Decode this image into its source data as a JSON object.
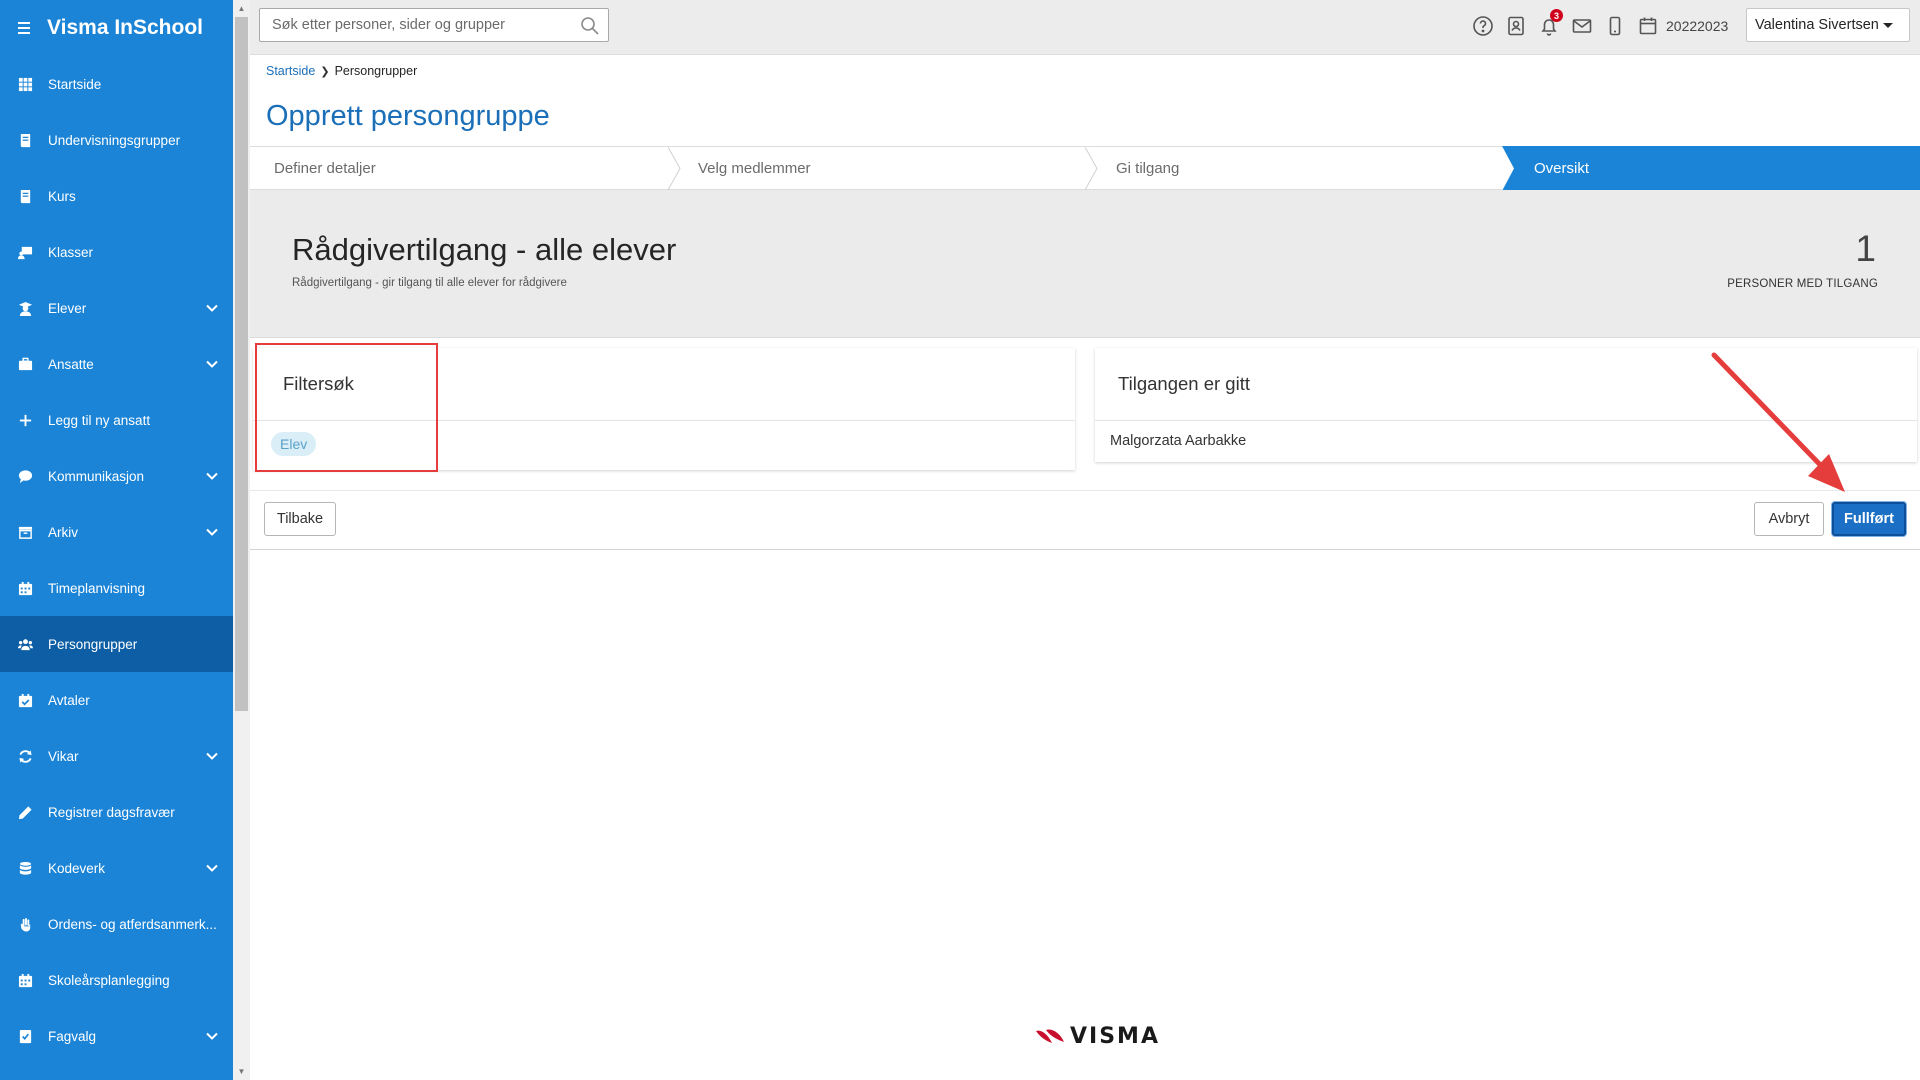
{
  "app": {
    "title": "Visma InSchool"
  },
  "sidebar": {
    "items": [
      {
        "label": "Startside",
        "icon": "grid-icon",
        "expandable": false
      },
      {
        "label": "Undervisningsgrupper",
        "icon": "book-icon",
        "expandable": false
      },
      {
        "label": "Kurs",
        "icon": "book-icon",
        "expandable": false
      },
      {
        "label": "Klasser",
        "icon": "classroom-icon",
        "expandable": false
      },
      {
        "label": "Elever",
        "icon": "student-icon",
        "expandable": true
      },
      {
        "label": "Ansatte",
        "icon": "briefcase-icon",
        "expandable": true
      },
      {
        "label": "Legg til ny ansatt",
        "icon": "plus-icon",
        "expandable": false
      },
      {
        "label": "Kommunikasjon",
        "icon": "chat-icon",
        "expandable": true
      },
      {
        "label": "Arkiv",
        "icon": "archive-icon",
        "expandable": true
      },
      {
        "label": "Timeplanvisning",
        "icon": "calendar-icon",
        "expandable": false
      },
      {
        "label": "Persongrupper",
        "icon": "users-icon",
        "expandable": false,
        "active": true
      },
      {
        "label": "Avtaler",
        "icon": "calendar-check-icon",
        "expandable": false
      },
      {
        "label": "Vikar",
        "icon": "refresh-icon",
        "expandable": true
      },
      {
        "label": "Registrer dagsfravær",
        "icon": "pencil-icon",
        "expandable": false
      },
      {
        "label": "Kodeverk",
        "icon": "database-icon",
        "expandable": true
      },
      {
        "label": "Ordens- og atferdsanmerk...",
        "icon": "hand-icon",
        "expandable": false
      },
      {
        "label": "Skoleårsplanlegging",
        "icon": "calendar-icon",
        "expandable": false
      },
      {
        "label": "Fagvalg",
        "icon": "checklist-icon",
        "expandable": true
      }
    ]
  },
  "topbar": {
    "search_placeholder": "Søk etter personer, sider og grupper",
    "notification_count": "3",
    "school_year": "20222023",
    "user_name": "Valentina Sivertsen"
  },
  "breadcrumb": {
    "home": "Startside",
    "current": "Persongrupper"
  },
  "page": {
    "title": "Opprett persongruppe"
  },
  "steps": [
    {
      "label": "Definer detaljer"
    },
    {
      "label": "Velg medlemmer"
    },
    {
      "label": "Gi tilgang"
    },
    {
      "label": "Oversikt",
      "active": true
    }
  ],
  "summary": {
    "title": "Rådgivertilgang - alle elever",
    "subtitle": "Rådgivertilgang - gir tilgang til alle elever for rådgivere",
    "count": "1",
    "count_label": "PERSONER MED TILGANG"
  },
  "filter_panel": {
    "title": "Filtersøk",
    "chips": [
      "Elev"
    ]
  },
  "access_panel": {
    "title": "Tilgangen er gitt",
    "people": [
      "Malgorzata Aarbakke"
    ]
  },
  "actions": {
    "back": "Tilbake",
    "cancel": "Avbryt",
    "finish": "Fullført"
  },
  "footer": {
    "brand": "VISMA"
  },
  "colors": {
    "sidebar": "#1b84d6",
    "active_nav": "#0d5ea5",
    "accent": "#1b6fb8",
    "annotation": "#e53c3c"
  }
}
